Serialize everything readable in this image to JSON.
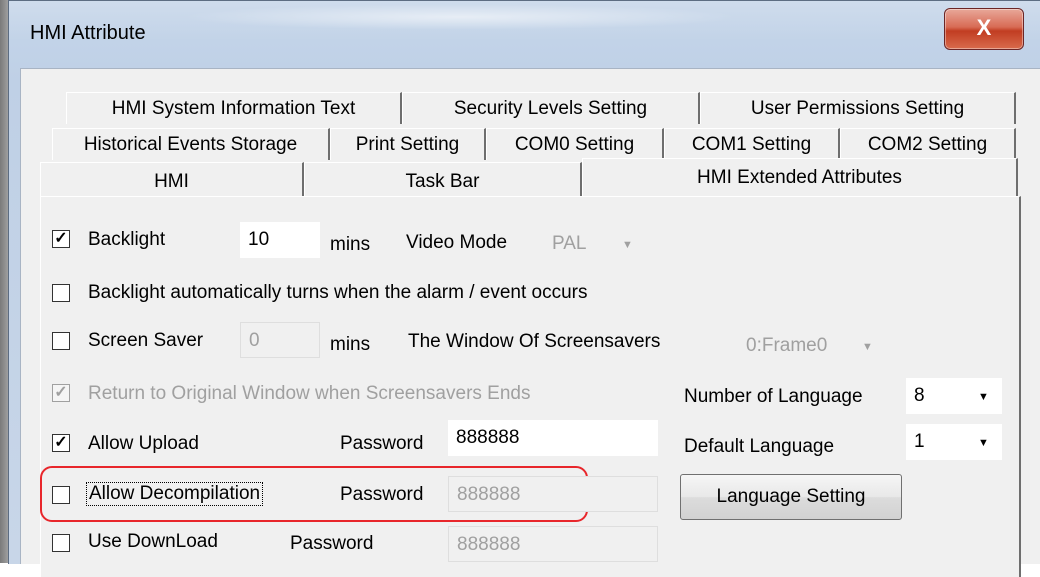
{
  "window": {
    "title": "HMI Attribute",
    "close_glyph": "X",
    "close_icon": "close-icon"
  },
  "tabs": {
    "row1": [
      "HMI System Information Text",
      "Security Levels Setting",
      "User Permissions Setting"
    ],
    "row2": [
      "Historical Events Storage",
      "Print Setting",
      "COM0 Setting",
      "COM1 Setting",
      "COM2 Setting"
    ],
    "row3": [
      "HMI",
      "Task Bar",
      "HMI Extended Attributes"
    ],
    "active": "HMI Extended Attributes"
  },
  "form": {
    "backlight": {
      "label": "Backlight",
      "checked": true,
      "value": "10",
      "unit": "mins"
    },
    "video_mode": {
      "label": "Video Mode",
      "value": "PAL"
    },
    "backlight_auto": {
      "label": "Backlight automatically turns when the alarm / event occurs",
      "checked": false
    },
    "screen_saver": {
      "label": "Screen Saver",
      "checked": false,
      "value": "0",
      "unit": "mins"
    },
    "screensaver_window": {
      "label": "The Window Of Screensavers",
      "value": "0:Frame0"
    },
    "return_original": {
      "label": "Return to Original Window when Screensavers Ends",
      "checked": true,
      "disabled": true
    },
    "num_language": {
      "label": "Number of Language",
      "value": "8"
    },
    "allow_upload": {
      "label": "Allow Upload",
      "checked": true,
      "password_label": "Password",
      "password": "888888"
    },
    "default_language": {
      "label": "Default Language",
      "value": "1"
    },
    "allow_decompilation": {
      "label": "Allow Decompilation",
      "checked": false,
      "password_label": "Password",
      "password": "888888"
    },
    "language_setting_button": "Language Setting",
    "use_download": {
      "label": "Use DownLoad",
      "checked": false,
      "password_label": "Password",
      "password": "888888"
    }
  },
  "check_glyph": "✓",
  "dropdown_glyph": "▼",
  "colors": {
    "highlight": "#e8262b",
    "title_bar": "#c2d3e8",
    "close_button": "#c13d22"
  }
}
